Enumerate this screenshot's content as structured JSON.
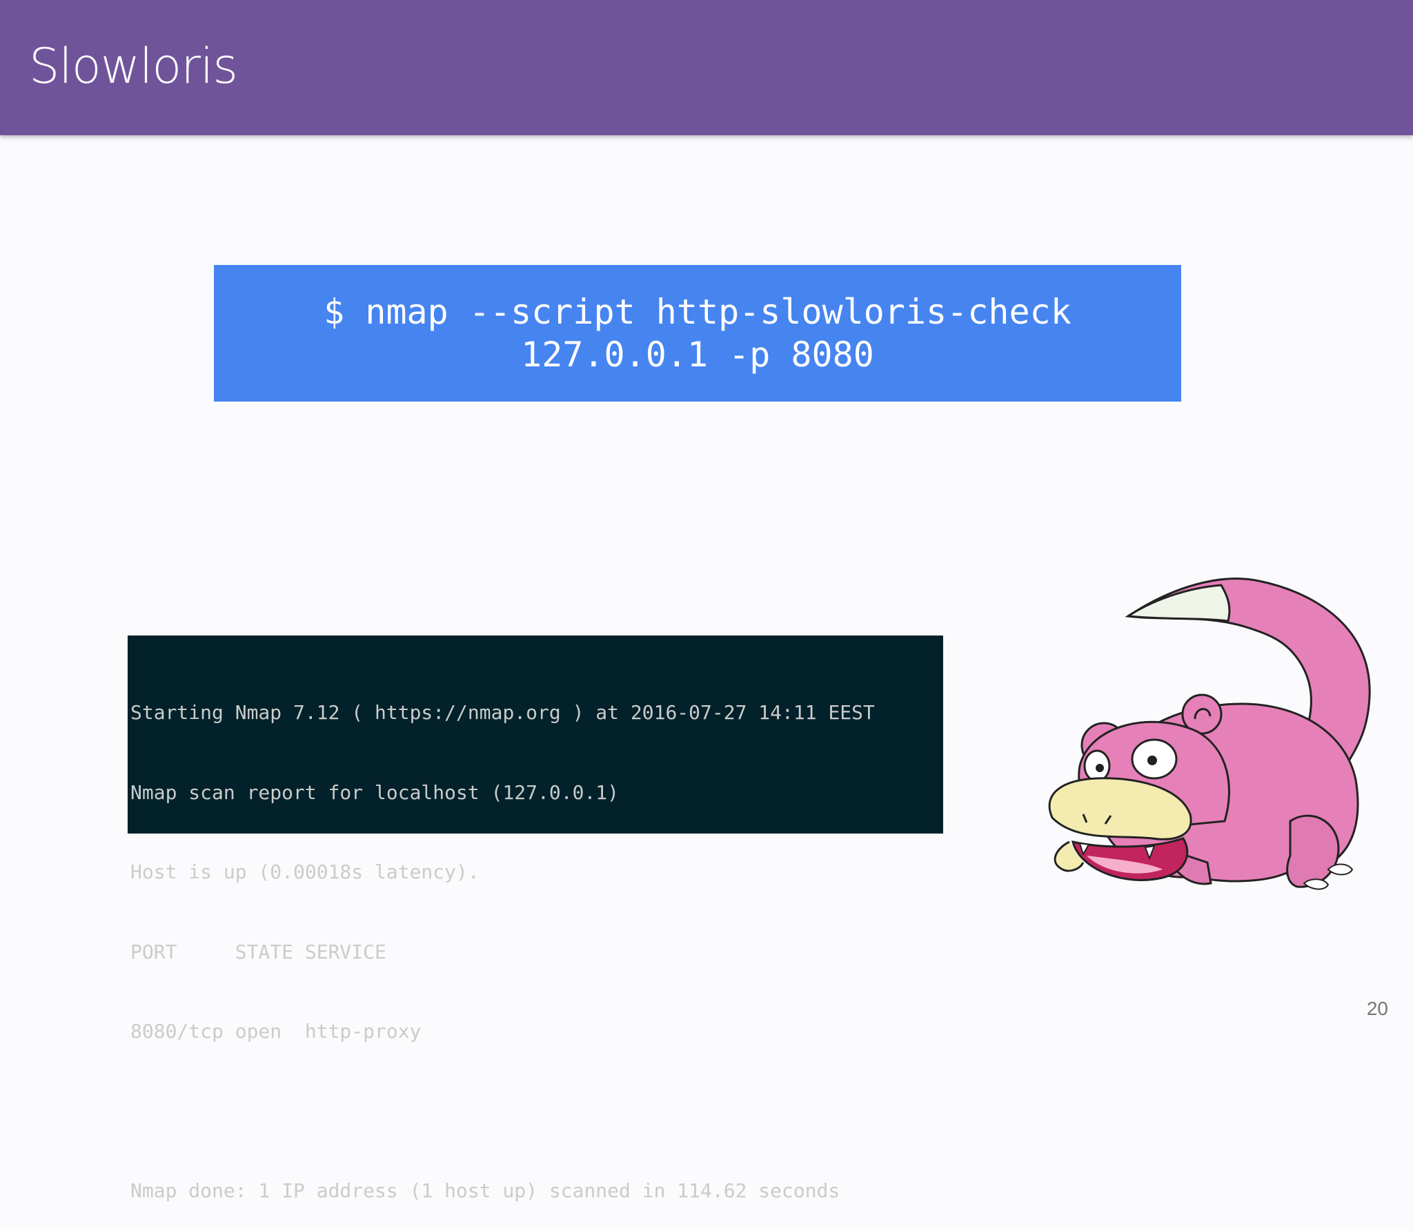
{
  "slide": {
    "title": "Slowloris",
    "page_number": "20"
  },
  "command": {
    "line1": "$ nmap --script http-slowloris-check",
    "line2": "127.0.0.1 -p 8080"
  },
  "terminal": {
    "lines": [
      "Starting Nmap 7.12 ( https://nmap.org ) at 2016-07-27 14:11 EEST",
      "Nmap scan report for localhost (127.0.0.1)",
      "Host is up (0.00018s latency).",
      "PORT     STATE SERVICE",
      "8080/tcp open  http-proxy",
      "",
      "Nmap done: 1 IP address (1 host up) scanned in 114.62 seconds"
    ]
  },
  "colors": {
    "header": "#70549a",
    "command_box": "#4684f0",
    "terminal_bg": "#03212b",
    "terminal_text": "#c9ccc9"
  },
  "image": {
    "icon": "slowpoke-illustration"
  }
}
